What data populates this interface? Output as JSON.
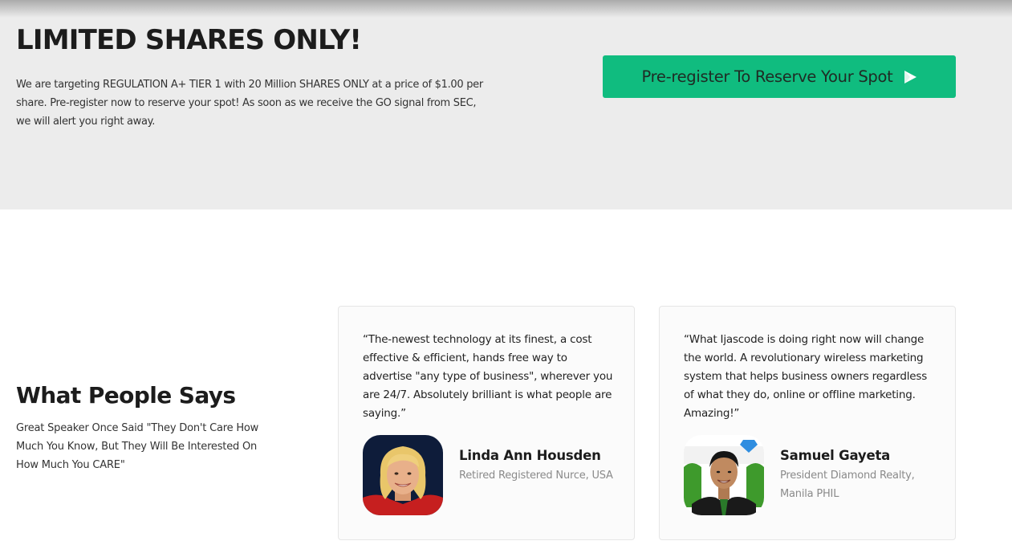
{
  "banner": {
    "title": "LIMITED SHARES ONLY!",
    "description": "We are targeting REGULATION A+ TIER 1 with 20 Million SHARES ONLY at a price of $1.00 per share. Pre-register now to reserve your spot! As soon as we receive the GO signal from SEC, we will alert you right away.",
    "cta_label": "Pre-register To Reserve Your Spot",
    "cta_icon": "play-arrow-icon",
    "cta_color": "#10bc7f",
    "background": "#ececec"
  },
  "testimonials": {
    "title": "What People Says",
    "description": "Great Speaker Once Said \"They Don't Care How Much You Know, But They Will Be Interested On How Much You CARE\"",
    "cards": [
      {
        "quote": "“The-newest technology at its finest, a cost effective & efficient, hands free way to advertise \"any type of business\", wherever you are 24/7. Absolutely brilliant is what people are saying.”",
        "name": "Linda Ann Housden",
        "role": "Retired Registered Nurce, USA"
      },
      {
        "quote": "“What Ijascode is doing right now will change the world. A revolutionary wireless marketing system that helps business owners regardless of what they do, online or offline marketing. Amazing!”",
        "name": "Samuel Gayeta",
        "role": "President Diamond Realty, Manila PHIL"
      }
    ]
  }
}
